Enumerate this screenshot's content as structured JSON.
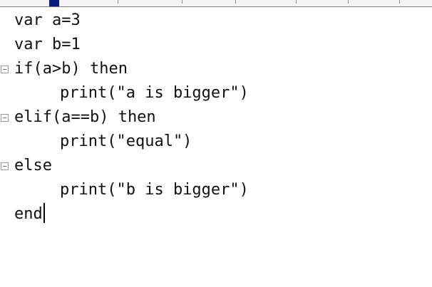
{
  "editor": {
    "lines": [
      {
        "text": "var a=3",
        "foldable": false,
        "indent": false
      },
      {
        "text": "var b=1",
        "foldable": false,
        "indent": false
      },
      {
        "text": "if(a>b) then",
        "foldable": true,
        "indent": false
      },
      {
        "text": "print(\"a is bigger\")",
        "foldable": false,
        "indent": true
      },
      {
        "text": "elif(a==b) then",
        "foldable": true,
        "indent": false
      },
      {
        "text": "print(\"equal\")",
        "foldable": false,
        "indent": true
      },
      {
        "text": "else",
        "foldable": true,
        "indent": false
      },
      {
        "text": "print(\"b is bigger\")",
        "foldable": false,
        "indent": true
      },
      {
        "text": "end",
        "foldable": false,
        "indent": false,
        "cursor": true
      }
    ],
    "fold_icon": "collapse-minus-icon"
  }
}
